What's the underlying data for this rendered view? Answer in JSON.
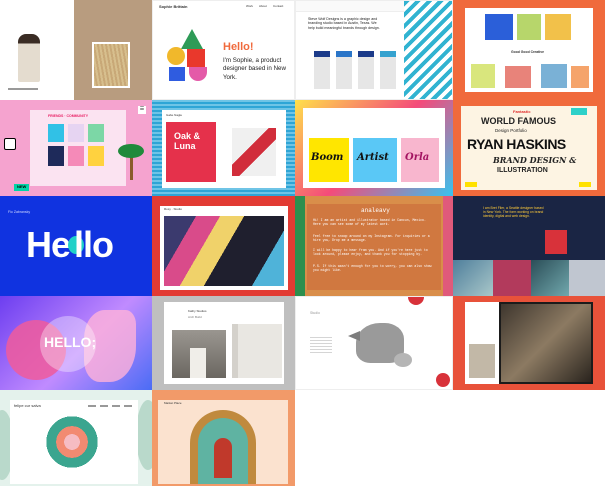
{
  "grid_title": "",
  "tiles": {
    "t2": {
      "logo": "Sophie Brittain",
      "nav": [
        "Work",
        "About",
        "Contact"
      ],
      "heading": "Hello!",
      "body": "I'm Sophie, a product designer based in New York."
    },
    "t3": {
      "text": "Steve Wolf Designs is a graphic design and branding studio based in Austin, Texas. We help build meaningful brands through design."
    },
    "t4": {
      "caption": "Good Good Creative"
    },
    "t5": {
      "banner": "FRIENDS · COMMUNITY",
      "new_badge": "NEW",
      "corner_icon": "☰"
    },
    "t6": {
      "title": "Oak & Luna",
      "nav": "Gabe Nagle"
    },
    "t7": {
      "words": [
        "Boom",
        "Artist",
        "Orla"
      ]
    },
    "t8": {
      "top": "Fantastic",
      "line1": "WORLD FAMOUS",
      "line2": "Design Portfolio",
      "name": "RYAN HASKINS",
      "line3": "BRAND DESIGN &",
      "line4": "ILLUSTRATION"
    },
    "t9": {
      "nav": "Fio Zabransky",
      "hello_a": "He",
      "hello_b": "llo"
    },
    "t10": {
      "logo": "Rosy · Studio"
    },
    "t11": {
      "name": "analeavy",
      "p1": "Hi! I am an artist and illustrator based in Cancun, Mexico. Here you can see some of my latest work.",
      "p2": "Feel free to snoop around on my Instagram. For inquiries or a hire you, Drop me a message.",
      "p3": "I will be happy to hear from you. And if you're here just to look around, please enjoy, and thank you for stopping by.",
      "p4": "P.S. If this wasn't enough for you to worry, you can also show you might like."
    },
    "t12": {
      "text": "I am Bret Filer, a Seattle designer based in New York. The form working on brand identity, digital and web design."
    },
    "t13": {
      "hello": "HELLO;"
    },
    "t14": {
      "logo": "Kathy Studios",
      "caption": "Arch Build"
    },
    "t15": {
      "logo": "Studio"
    },
    "t17": {
      "logo": "felipe cur salva"
    },
    "t18": {
      "logo": "Market Place"
    }
  },
  "colors": {
    "orange": "#F06A3C",
    "blue": "#1033E0",
    "pink": "#F5A3CF",
    "teal": "#19B1C8",
    "red": "#E23B33",
    "yellow": "#FCE300",
    "purple": "#7B4FE3",
    "navy": "#1A2544"
  }
}
